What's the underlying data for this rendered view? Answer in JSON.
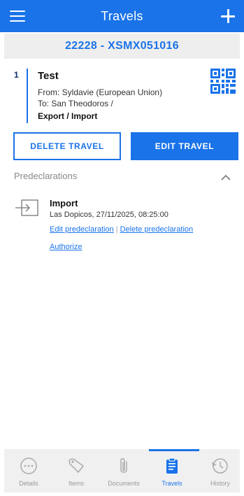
{
  "header": {
    "title": "Travels",
    "menu_icon": "hamburger-icon",
    "add_icon": "plus-icon"
  },
  "travel_id": "22228 - XSMX051016",
  "travel": {
    "number": "1",
    "name": "Test",
    "from": "From: Syldavie (European Union)",
    "to": "To: San Theodoros /",
    "kind": "Export / Import",
    "qr_icon": "qr-code-icon"
  },
  "actions": {
    "delete_label": "DELETE TRAVEL",
    "edit_label": "EDIT TRAVEL"
  },
  "predeclarations": {
    "title": "Predeclarations",
    "items": [
      {
        "title": "Import",
        "subtitle": "Las Dopicos, 27/11/2025, 08:25:00",
        "edit_link": "Edit predeclaration",
        "delete_link": "Delete predeclaration",
        "authorize_link": "Authorize"
      }
    ]
  },
  "bottom_nav": {
    "active": "Travels",
    "items": [
      {
        "label": "Details",
        "icon": "details-icon"
      },
      {
        "label": "Items",
        "icon": "items-icon"
      },
      {
        "label": "Documents",
        "icon": "paperclip-icon"
      },
      {
        "label": "Travels",
        "icon": "clipboard-icon"
      },
      {
        "label": "History",
        "icon": "history-icon"
      }
    ]
  },
  "colors": {
    "primary": "#1a73e8",
    "nav_background": "#f0f0f0",
    "id_bar_background": "#eeeeee"
  }
}
